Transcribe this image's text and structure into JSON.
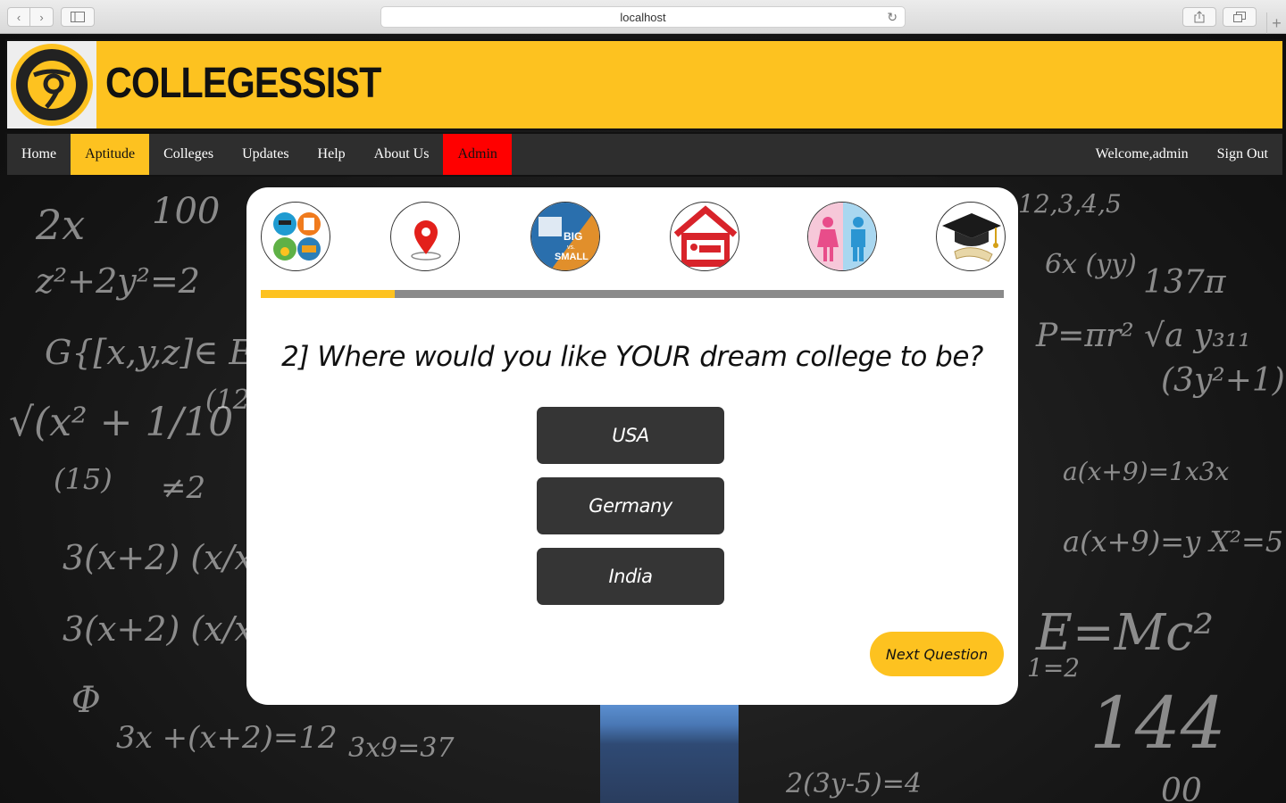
{
  "browser": {
    "url": "localhost"
  },
  "header": {
    "brand": "COLLEGESSIST"
  },
  "nav": {
    "items": [
      "Home",
      "Aptitude",
      "Colleges",
      "Updates",
      "Help",
      "About Us",
      "Admin"
    ],
    "active": "Aptitude",
    "welcome": "Welcome,admin",
    "sign_out": "Sign Out"
  },
  "quiz": {
    "steps": [
      "courses-icon",
      "location-pin-icon",
      "big-vs-small-icon",
      "accommodation-bed-icon",
      "gender-icon",
      "graduation-icon"
    ],
    "step_badge_big": "BIG",
    "step_badge_vs": "vs.",
    "step_badge_small": "SMALL",
    "progress": 0.18,
    "question": "2] Where would you like YOUR dream college to be?",
    "options": [
      "USA",
      "Germany",
      "India"
    ],
    "next_label": "Next Question"
  },
  "colors": {
    "accent": "#fdc220",
    "nav_bg": "#2e2e2e",
    "admin_bg": "#ff0000",
    "option_bg": "#353535"
  }
}
